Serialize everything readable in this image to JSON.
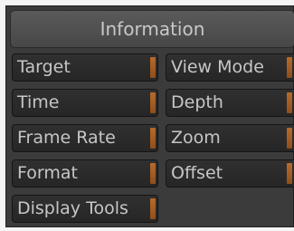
{
  "panel": {
    "title": "Information",
    "buttons": [
      {
        "label": "Target"
      },
      {
        "label": "View Mode"
      },
      {
        "label": "Time"
      },
      {
        "label": "Depth"
      },
      {
        "label": "Frame Rate"
      },
      {
        "label": "Zoom"
      },
      {
        "label": "Format"
      },
      {
        "label": "Offset"
      },
      {
        "label": "Display Tools"
      }
    ]
  },
  "colors": {
    "panel_bg": "#3b3b3b",
    "button_bg": "#2a2a2a",
    "accent_tab": "#a85e24",
    "text": "#c6c6c6"
  }
}
